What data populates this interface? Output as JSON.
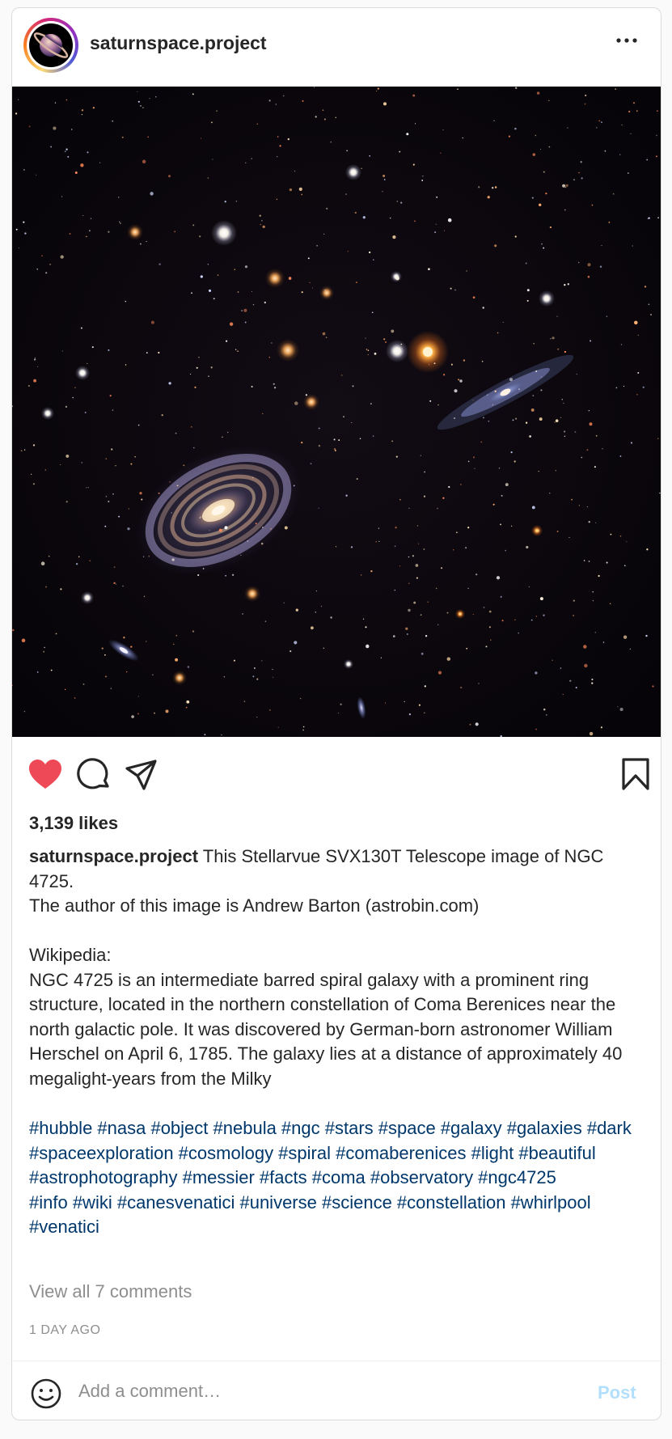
{
  "post": {
    "username": "saturnspace.project",
    "likes": "3,139 likes",
    "caption": {
      "username": "saturnspace.project",
      "text": " This Stellarvue SVX130T Telescope image of NGC 4725.\nThe author of this image is Andrew Barton (astrobin.com)\n\nWikipedia:\nNGC 4725 is an intermediate barred spiral galaxy with a prominent ring structure, located in the northern constellation of Coma Berenices near the north galactic pole. It was discovered by German-born astronomer William Herschel on April 6, 1785. The galaxy lies at a distance of approximately 40 megalight-years from the Milky"
    },
    "hashtags": "#hubble #nasa #object #nebula #ngc #stars #space #galaxy #galaxies #dark #spaceexploration #cosmology #spiral #comaberenices #light #beautiful #astrophotography #messier #facts #coma #observatory #ngc4725\n#info #wiki #canesvenatici #universe #science #constellation #whirlpool #venatici",
    "view_comments": "View all 7 comments",
    "timestamp": "1 DAY AGO"
  },
  "comment_box": {
    "placeholder": "Add a comment…",
    "post_label": "Post"
  },
  "icons": {
    "more": "more-options-icon",
    "like": "heart-filled-icon",
    "comment": "comment-icon",
    "share": "share-icon",
    "save": "bookmark-icon",
    "emoji": "emoji-icon"
  },
  "colors": {
    "heart": "#ed4956",
    "hashtag": "#00376b",
    "post_disabled": "#b2dffc",
    "muted": "#8e8e8e",
    "avatar_ring": "#d62976"
  },
  "image_alt": "NGC 4725"
}
